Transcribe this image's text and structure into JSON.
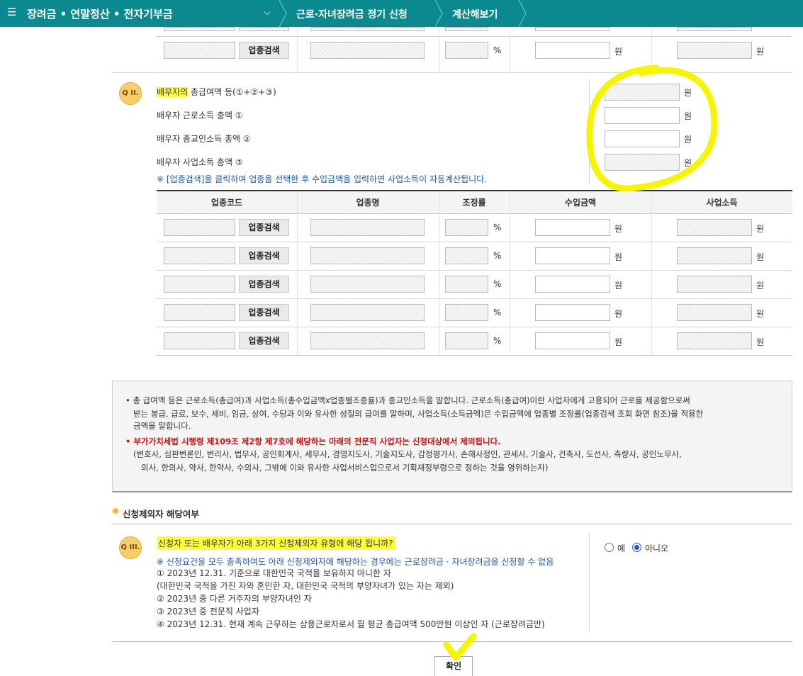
{
  "topbar": {
    "menu_icon": "☰",
    "section": "장려금 • 연말정산 • 전자기부금",
    "dropdown_icon": "chevron-down-icon",
    "crumb1": "근로·자녀장려금 정기 신청",
    "crumb2": "계산해보기",
    "color": "#0a8a8f"
  },
  "units": {
    "won": "원",
    "percent": "%"
  },
  "search_label": "업종검색",
  "q2": {
    "badge": "Q II.",
    "title_highlight": "배우자의",
    "title_rest": " 총급여액 등(①+②+③)",
    "row1": "배우자 근로소득 총액 ①",
    "row2": "배우자 종교인소득 총액 ②",
    "row3": "배우자 사업소득 총액 ③",
    "note": "※ [업종검색]을 클릭하여 업종을 선택한 후 수입금액을 입력하면 사업소득이 자동계산됩니다.",
    "values": {
      "total": "",
      "labor": "",
      "religious": "",
      "business": ""
    }
  },
  "table": {
    "headers": [
      "업종코드",
      "업종명",
      "조정률",
      "수입금액",
      "사업소득"
    ],
    "rows": [
      {
        "code": "",
        "name": "",
        "rate": "",
        "income": "",
        "business_income": ""
      },
      {
        "code": "",
        "name": "",
        "rate": "",
        "income": "",
        "business_income": ""
      },
      {
        "code": "",
        "name": "",
        "rate": "",
        "income": "",
        "business_income": ""
      },
      {
        "code": "",
        "name": "",
        "rate": "",
        "income": "",
        "business_income": ""
      },
      {
        "code": "",
        "name": "",
        "rate": "",
        "income": "",
        "business_income": ""
      }
    ]
  },
  "note_box": {
    "line1": "• 총 급여액 등은 근로소득(총급여)과 사업소득(총수입금액x업종별조종률)과 종교인소득을 말합니다. 근로소득(총급여)이란 사업자에게 고용되어 근로를 제공함으로써",
    "line2": "받는 봉급, 급료, 보수, 세비, 임금, 상여, 수당과 이와 유사한 성질의 급여를 말하며, 사업소득(소득금액)은 수입금액에 업종별 조정률(업종검색 조회 화면 참조)을 적용한",
    "line3": "금액을 말합니다.",
    "line4": "• 부가가치세법 시행령 제109조 제2항 제7호에 해당하는 아래의 전문직 사업자는 신청대상에서 제외됩니다.",
    "line5": "(변호사, 심판변론인, 변리사, 법무사, 공인회계사, 세무사, 경영지도사, 기술지도사, 감정평가사, 손해사정인, 관세사, 기술사, 건축사, 도선사, 측량사, 공인노무사,",
    "line6": "의사, 한의사, 약사, 한약사, 수의사, 그밖에 이와 유사한 사업서비스업으로서 기획재정부령으로 정하는 것을 영위하는자)"
  },
  "exclusion": {
    "heading": "신청제외자 해당여부",
    "badge": "Q III.",
    "question": "신청자 또는 배우자가 아래 3가지 신청제외자 유형에 해당 됩니까?",
    "note": "※ 신청요건을 모두 충족하여도 아래 신청제외자에 해당하는 경우에는 근로장려금 · 자녀장려금을 신청할 수 없음",
    "item1": "① 2023년 12.31. 기준으로 대한민국 국적을 보유하지 아니한 자",
    "item1b": "(대한민국 국적을 가진 자와 혼인한 자, 대한민국 국적의 부양자녀가 있는 자는 제외)",
    "item2": "② 2023년 중 다른 거주자의 부양자녀인 자",
    "item3": "③ 2023년 중 전문직 사업자",
    "item4": "④ 2023년 12.31. 현재 계속 근무하는 상용근로자로서 월 평균 총급여액 500만원 이상인 자 (근로장려금만)",
    "option_yes": "예",
    "option_no": "아니오",
    "selected": "아니오"
  },
  "confirm_label": "확인",
  "annotation_color": "#f5f500"
}
